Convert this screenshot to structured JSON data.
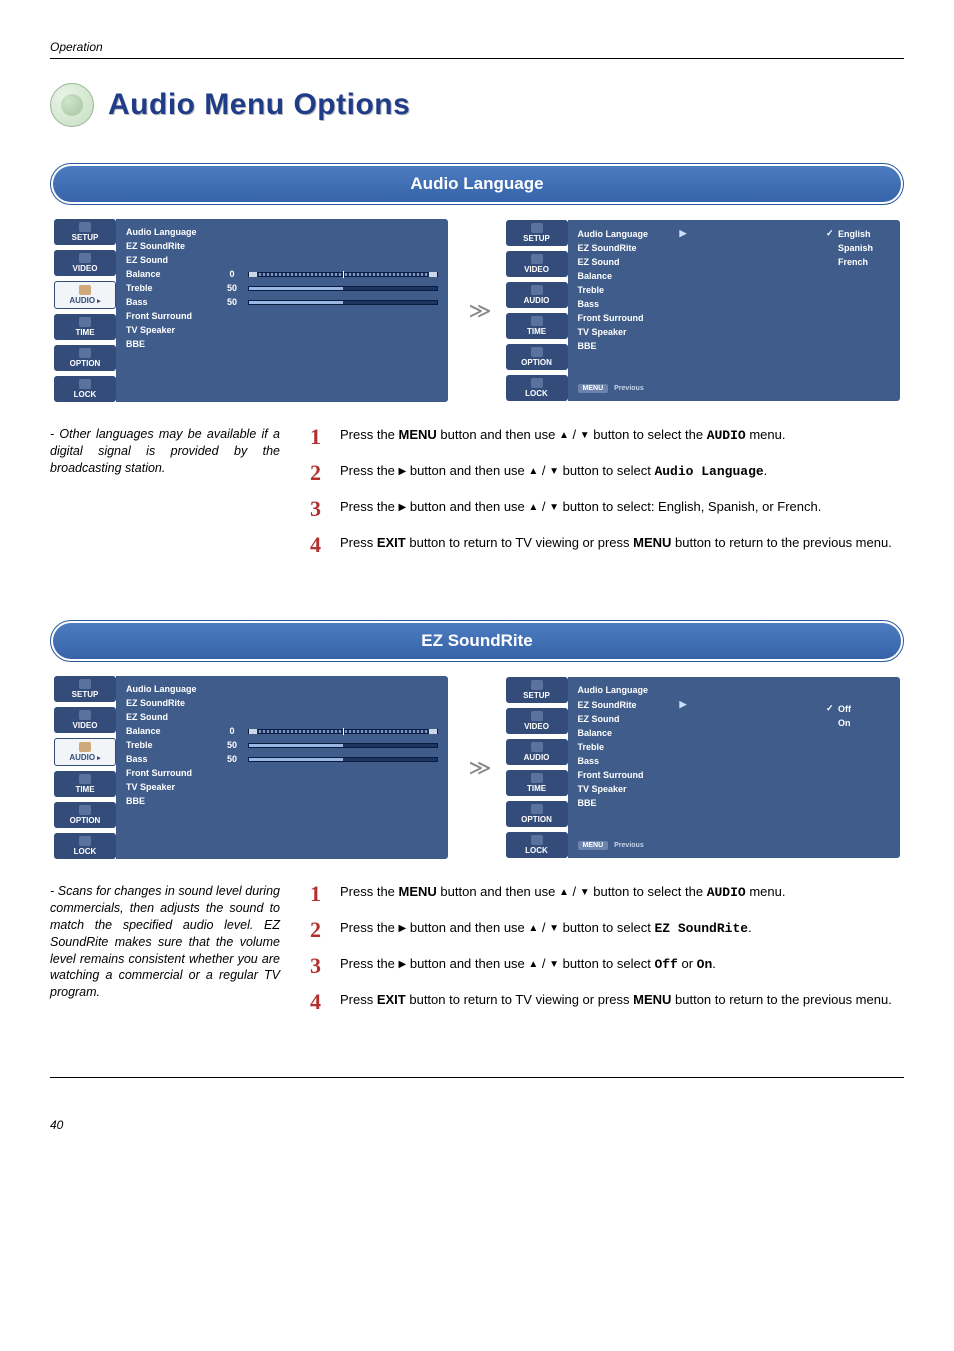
{
  "header": {
    "section": "Operation",
    "page_number": "40"
  },
  "title": "Audio Menu Options",
  "osd": {
    "tabs": [
      "SETUP",
      "VIDEO",
      "AUDIO",
      "TIME",
      "OPTION",
      "LOCK"
    ],
    "items": [
      "Audio Language",
      "EZ SoundRite",
      "EZ Sound",
      "Balance",
      "Treble",
      "Bass",
      "Front Surround",
      "TV Speaker",
      "BBE"
    ],
    "values": {
      "balance": "0",
      "treble": "50",
      "bass": "50"
    },
    "menu_btn": "MENU",
    "previous": "Previous"
  },
  "section1": {
    "title": "Audio Language",
    "options": [
      "English",
      "Spanish",
      "French"
    ],
    "checked": "English",
    "note": "Other languages may be available if a digital signal is provided by the broadcasting station.",
    "steps": {
      "s1_a": "Press the ",
      "s1_b": "MENU",
      "s1_c": " button and then use ",
      "s1_d": " button to select the ",
      "s1_e": "AUDIO",
      "s1_f": " menu.",
      "s2_a": "Press the ",
      "s2_b": " button and then use ",
      "s2_c": " button to select ",
      "s2_d": "Audio Language",
      "s2_e": ".",
      "s3_a": "Press the ",
      "s3_b": " button and then use ",
      "s3_c": " button to select: English, Spanish, or French.",
      "s4_a": "Press ",
      "s4_b": "EXIT",
      "s4_c": " button to return to TV viewing or press ",
      "s4_d": "MENU",
      "s4_e": " button to return to the previous menu."
    }
  },
  "section2": {
    "title": "EZ SoundRite",
    "options": [
      "Off",
      "On"
    ],
    "checked": "Off",
    "note": "Scans for changes in sound level during commercials, then adjusts the sound to match the specified audio level. EZ SoundRite makes sure that the volume level remains consistent whether you are watching a commercial or a regular TV program.",
    "steps": {
      "s1_a": "Press the ",
      "s1_b": "MENU",
      "s1_c": " button and then use ",
      "s1_d": " button to select the ",
      "s1_e": "AUDIO",
      "s1_f": " menu.",
      "s2_a": "Press the ",
      "s2_b": " button and then use ",
      "s2_c": " button to select ",
      "s2_d": "EZ SoundRite",
      "s2_e": ".",
      "s3_a": "Press the ",
      "s3_b": " button and then use ",
      "s3_c": " button to select ",
      "s3_d": "Off",
      "s3_e": " or ",
      "s3_f": "On",
      "s3_g": ".",
      "s4_a": "Press ",
      "s4_b": "EXIT",
      "s4_c": " button to return to TV viewing or press ",
      "s4_d": "MENU",
      "s4_e": " button to return to the previous menu."
    }
  },
  "symbols": {
    "up": "▲",
    "down": "▼",
    "right": "▶",
    "slash": " / ",
    "check": "✓"
  }
}
